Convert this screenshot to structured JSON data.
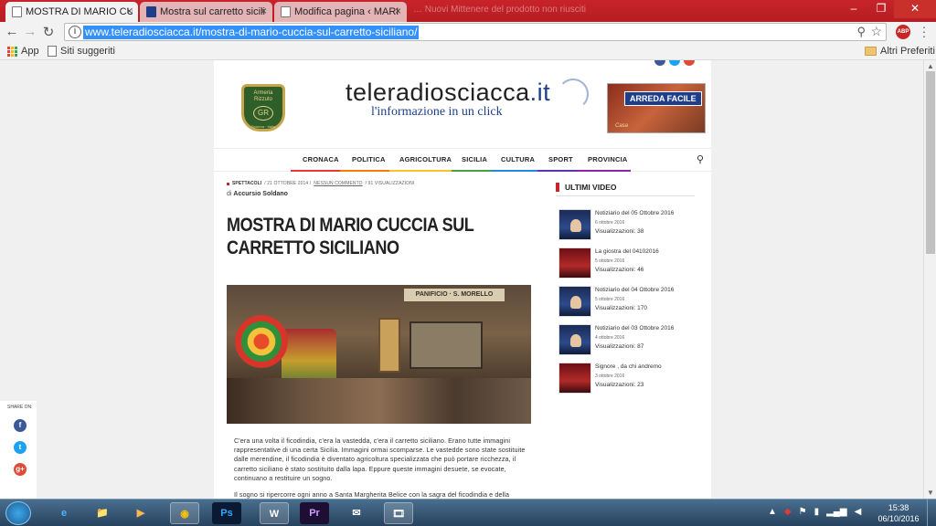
{
  "browser": {
    "tabs": [
      {
        "label": "MOSTRA DI MARIO CUC",
        "active": true
      },
      {
        "label": "Mostra sul carretto sicili",
        "active": false
      },
      {
        "label": "Modifica pagina ‹ MARI",
        "active": false
      }
    ],
    "faded_tab": "… Nuovi Mittenere del prodotto non riusciti",
    "url": "www.teleradiosciacca.it/mostra-di-mario-cuccia-sul-carretto-siciliano/",
    "extension_badge": "ABP",
    "bookmarks": {
      "apps_label": "App",
      "suggested_label": "Siti suggeriti",
      "other_label": "Altri Preferiti"
    },
    "accent": "#c8232a"
  },
  "site": {
    "armeria": {
      "line1": "Armeria",
      "line2": "Rizzuto",
      "mono": "GR",
      "line3": "Sciacca · Italia"
    },
    "logo": {
      "wordmark_a": "teleradiosciacca",
      "wordmark_b": ".it",
      "tagline": "l'informazione in un click"
    },
    "ad": {
      "brand": "ARREDA FACILE",
      "sub": "Casa"
    },
    "nav": [
      {
        "label": "CRONACA",
        "color": "#e53935"
      },
      {
        "label": "POLITICA",
        "color": "#f57c00"
      },
      {
        "label": "AGRICOLTURA",
        "color": "#fbc02d"
      },
      {
        "label": "SICILIA",
        "color": "#43a047"
      },
      {
        "label": "CULTURA",
        "color": "#1e88e5"
      },
      {
        "label": "SPORT",
        "color": "#5e35b1"
      },
      {
        "label": "PROVINCIA",
        "color": "#8e24aa"
      }
    ],
    "article": {
      "category": "SPETTACOLI",
      "date": "/ 21 OTTOBRE 2014 /",
      "comments": "NESSUN COMMENTO",
      "views": "/ 91 VISUALIZZAZIONI",
      "author_prefix": "di",
      "author": "Accursio Soldano",
      "title": "MOSTRA DI MARIO CUCCIA SUL CARRETTO SICILIANO",
      "photo_sign": "PANIFICIO · S. MORELLO",
      "paragraph1": "C'era una volta il ficodindia, c'era la vastedda, c'era il carretto siciliano. Erano tutte immagini rappresentative di una certa Sicilia. Immagini ormai scomparse. Le vastedde sono state sostituite dalle merendine, il ficodindia è diventato agricoltura specializzata che può portare ricchezza, il carretto siciliano è stato sostituito dalla lapa. Eppure queste immagini desuete, se evocate, continuano a restituire un sogno.",
      "paragraph2": "Il sogno si ripercorre ogni anno a Santa Margherita Belice con la sagra del ficodindia e della vastedda,"
    },
    "sidebar": {
      "title": "ULTIMI VIDEO",
      "videos": [
        {
          "title": "Notiziario del 05 Ottobre 2016",
          "date": "6 ottobre 2016",
          "views": "Visualizzazioni: 38"
        },
        {
          "title": "La giostra del 04102016",
          "date": "5 ottobre 2016",
          "views": "Visualizzazioni: 46"
        },
        {
          "title": "Notiziario del 04 Ottobre 2016",
          "date": "5 ottobre 2016",
          "views": "Visualizzazioni: 170"
        },
        {
          "title": "Notiziario del 03 Ottobre 2016",
          "date": "4 ottobre 2016",
          "views": "Visualizzazioni: 87"
        },
        {
          "title": "Signore , da chi andremo",
          "date": "3 ottobre 2016",
          "views": "Visualizzazioni: 23"
        }
      ]
    },
    "share": {
      "label": "SHARE ON:",
      "fb": "f",
      "tw": "t",
      "gp": "g+"
    }
  },
  "taskbar": {
    "time": "15:38",
    "date": "06/10/2016",
    "apps": [
      "e",
      "📁",
      "▶",
      "◉",
      "Ps",
      "W",
      "Pr",
      "✉",
      "🎞"
    ]
  }
}
